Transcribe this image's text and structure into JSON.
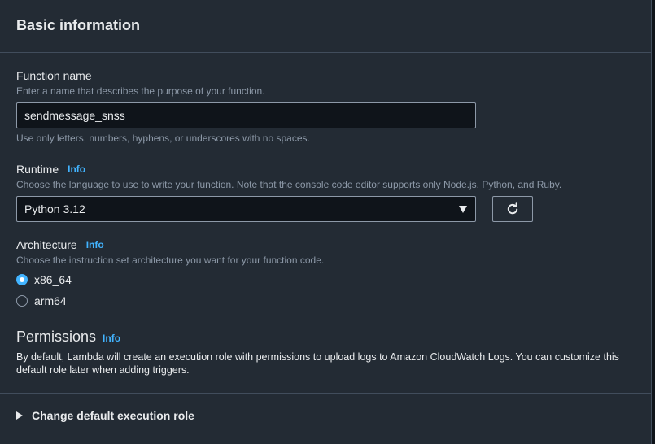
{
  "section": {
    "title": "Basic information"
  },
  "function_name": {
    "label": "Function name",
    "description": "Enter a name that describes the purpose of your function.",
    "value": "sendmessage_snss",
    "constraint": "Use only letters, numbers, hyphens, or underscores with no spaces."
  },
  "runtime": {
    "label": "Runtime",
    "info": "Info",
    "description": "Choose the language to use to write your function. Note that the console code editor supports only Node.js, Python, and Ruby.",
    "selected": "Python 3.12",
    "refresh_icon": "refresh-icon"
  },
  "architecture": {
    "label": "Architecture",
    "info": "Info",
    "description": "Choose the instruction set architecture you want for your function code.",
    "options": [
      {
        "label": "x86_64",
        "checked": true
      },
      {
        "label": "arm64",
        "checked": false
      }
    ]
  },
  "permissions": {
    "title": "Permissions",
    "info": "Info",
    "description": "By default, Lambda will create an execution role with permissions to upload logs to Amazon CloudWatch Logs. You can customize this default role later when adding triggers."
  },
  "expander": {
    "label": "Change default execution role"
  },
  "colors": {
    "background": "#232b34",
    "accent": "#42b4ff",
    "border": "#414d5c",
    "input_bg": "#0f141a"
  }
}
